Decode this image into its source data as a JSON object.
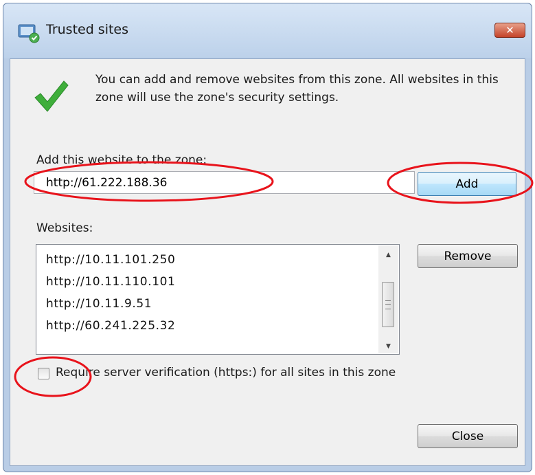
{
  "window": {
    "title": "Trusted sites",
    "close_glyph": "✕"
  },
  "intro": {
    "text": "You can add and remove websites from this zone. All websites in this zone will use the zone's security settings."
  },
  "add_section": {
    "label": "Add this website to the zone:",
    "input_value": "http://61.222.188.36",
    "add_button": "Add"
  },
  "websites": {
    "label": "Websites:",
    "items": [
      "http://10.11.101.250",
      "http://10.11.110.101",
      "http://10.11.9.51",
      "http://60.241.225.32"
    ],
    "remove_button": "Remove"
  },
  "verification": {
    "label": "Require server verification (https:) for all sites in this zone",
    "checked": false
  },
  "footer": {
    "close_button": "Close"
  },
  "icons": {
    "title": "trusted-sites-icon",
    "check": "green-checkmark-icon"
  },
  "colors": {
    "annotation": "#e8131b",
    "check_green": "#3fae3b",
    "title_bar": "#bcd1ea"
  }
}
